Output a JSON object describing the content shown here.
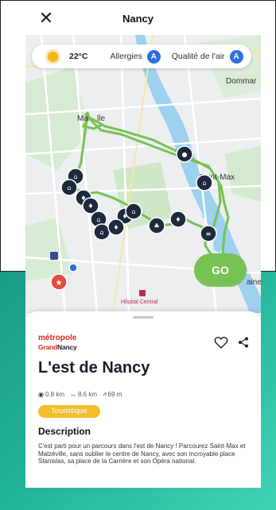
{
  "header": {
    "title": "Nancy",
    "close_icon": "close-icon"
  },
  "weather": {
    "temperature": "22°C",
    "allergies_label": "Allergies",
    "allergies_badge": "A",
    "air_label": "Qualité de l'air",
    "air_badge": "A"
  },
  "map": {
    "labels": {
      "dommartin": "Dommar",
      "malzeville": "Ma    lle",
      "saint_max": "Saint-Max",
      "hopital": "Hôpital Central",
      "aine": "aine"
    },
    "route_color": "#78c154"
  },
  "go_button": "GO",
  "sheet": {
    "logo_top": "métropole",
    "logo_grand": "Grand",
    "logo_nancy": "Nancy",
    "title": "L'est de Nancy",
    "stats": {
      "distance": "0.8 km",
      "length": "8.6 km",
      "elevation": "69 m"
    },
    "tag": "Touristique",
    "description_title": "Description",
    "description": "C'est parti pour un parcours dans l'est de Nancy ! Parcourez Saint-Max et Malzéville, sans oublier le centre de Nancy, avec son incroyable place Stanislas, sa place de la Carrière et son Opéra national."
  },
  "colors": {
    "accent_green": "#78c154",
    "badge_blue": "#2f6fe0",
    "tag_yellow": "#f3bd2b",
    "teal": "#22b39a",
    "logo_red": "#d7271b"
  }
}
